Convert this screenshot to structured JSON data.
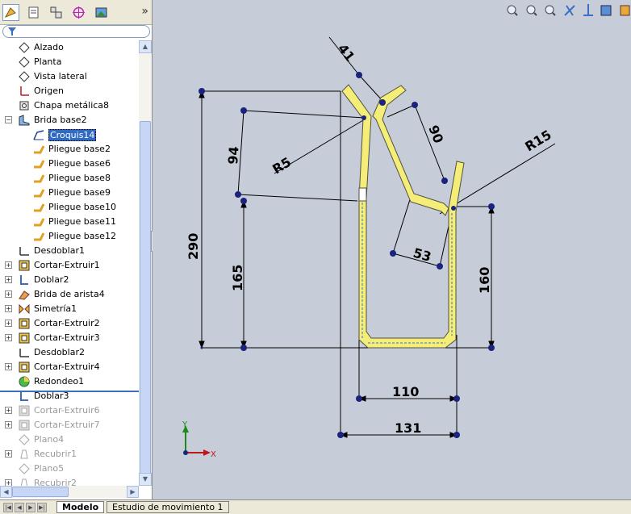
{
  "feature_tree": {
    "items": [
      {
        "label": "Alzado",
        "icon": "plane-icon",
        "level": 1,
        "state": "normal"
      },
      {
        "label": "Planta",
        "icon": "plane-icon",
        "level": 1,
        "state": "normal"
      },
      {
        "label": "Vista lateral",
        "icon": "plane-icon",
        "level": 1,
        "state": "normal"
      },
      {
        "label": "Origen",
        "icon": "origin-icon",
        "level": 1,
        "state": "normal"
      },
      {
        "label": "Chapa metálica8",
        "icon": "sheet-metal-icon",
        "level": 1,
        "state": "normal"
      },
      {
        "label": "Brida base2",
        "icon": "base-flange-icon",
        "level": 1,
        "state": "expanded"
      },
      {
        "label": "Croquis14",
        "icon": "sketch-icon",
        "level": 2,
        "state": "selected"
      },
      {
        "label": "Pliegue base2",
        "icon": "bend-icon",
        "level": 2,
        "state": "normal"
      },
      {
        "label": "Pliegue base6",
        "icon": "bend-icon",
        "level": 2,
        "state": "normal"
      },
      {
        "label": "Pliegue base8",
        "icon": "bend-icon",
        "level": 2,
        "state": "normal"
      },
      {
        "label": "Pliegue base9",
        "icon": "bend-icon",
        "level": 2,
        "state": "normal"
      },
      {
        "label": "Pliegue base10",
        "icon": "bend-icon",
        "level": 2,
        "state": "normal"
      },
      {
        "label": "Pliegue base11",
        "icon": "bend-icon",
        "level": 2,
        "state": "normal"
      },
      {
        "label": "Pliegue base12",
        "icon": "bend-icon",
        "level": 2,
        "state": "normal"
      },
      {
        "label": "Desdoblar1",
        "icon": "unfold-icon",
        "level": 1,
        "state": "normal"
      },
      {
        "label": "Cortar-Extruir1",
        "icon": "cut-extrude-icon",
        "level": 1,
        "state": "collapsed"
      },
      {
        "label": "Doblar2",
        "icon": "fold-icon",
        "level": 1,
        "state": "collapsed"
      },
      {
        "label": "Brida de arista4",
        "icon": "edge-flange-icon",
        "level": 1,
        "state": "collapsed"
      },
      {
        "label": "Simetría1",
        "icon": "mirror-icon",
        "level": 1,
        "state": "collapsed"
      },
      {
        "label": "Cortar-Extruir2",
        "icon": "cut-extrude-icon",
        "level": 1,
        "state": "collapsed"
      },
      {
        "label": "Cortar-Extruir3",
        "icon": "cut-extrude-icon",
        "level": 1,
        "state": "collapsed"
      },
      {
        "label": "Desdoblar2",
        "icon": "unfold-icon",
        "level": 1,
        "state": "normal"
      },
      {
        "label": "Cortar-Extruir4",
        "icon": "cut-extrude-icon",
        "level": 1,
        "state": "collapsed"
      },
      {
        "label": "Redondeo1",
        "icon": "fillet-icon",
        "level": 1,
        "state": "normal"
      },
      {
        "label": "Doblar3",
        "icon": "fold-icon",
        "level": 1,
        "state": "normal"
      },
      {
        "label": "Cortar-Extruir6",
        "icon": "cut-extrude-icon",
        "level": 1,
        "state": "suppressed-collapsed"
      },
      {
        "label": "Cortar-Extruir7",
        "icon": "cut-extrude-icon",
        "level": 1,
        "state": "suppressed-collapsed"
      },
      {
        "label": "Plano4",
        "icon": "plane-icon",
        "level": 1,
        "state": "suppressed"
      },
      {
        "label": "Recubrir1",
        "icon": "loft-icon",
        "level": 1,
        "state": "suppressed-collapsed"
      },
      {
        "label": "Plano5",
        "icon": "plane-icon",
        "level": 1,
        "state": "suppressed"
      },
      {
        "label": "Recubrir2",
        "icon": "loft-icon",
        "level": 1,
        "state": "suppressed-collapsed"
      }
    ]
  },
  "sketch": {
    "dimensions": {
      "d41": "41",
      "d94": "94",
      "r5": "R5",
      "d90": "90",
      "r15": "R15",
      "d290": "290",
      "d165": "165",
      "d53": "53",
      "d160": "160",
      "d110": "110",
      "d131": "131"
    },
    "triad": {
      "x": "X",
      "y": "Y"
    }
  },
  "bottom_tabs": {
    "model": "Modelo",
    "motion_study": "Estudio de movimiento 1"
  },
  "colors": {
    "sketch_fill": "#f4ee78",
    "selection_blue": "#316ac5",
    "graphics_bg": "#c7cdd8",
    "dimension_point": "#1a237e"
  }
}
